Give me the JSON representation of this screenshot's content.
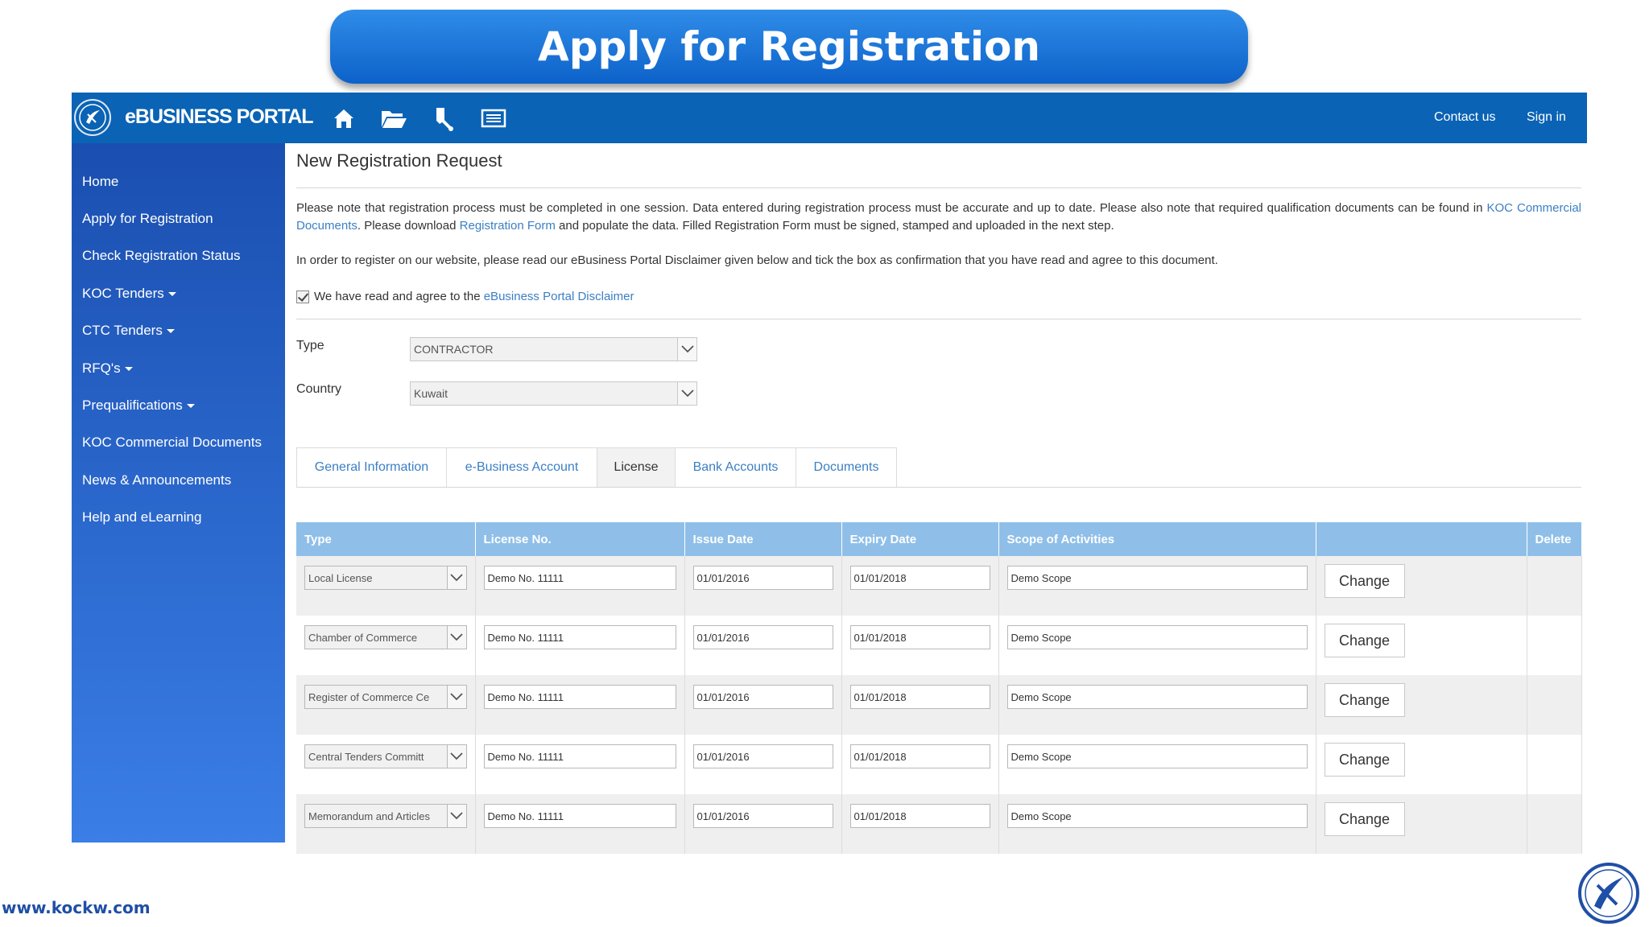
{
  "banner": {
    "title": "Apply for Registration"
  },
  "header": {
    "portal_title": "eBUSINESS PORTAL",
    "nav_icons": [
      "home-icon",
      "folder-icon",
      "tools-icon",
      "list-icon"
    ],
    "contact_label": "Contact us",
    "signin_label": "Sign in"
  },
  "sidebar": {
    "items": [
      {
        "label": "Home",
        "dropdown": false
      },
      {
        "label": "Apply for Registration",
        "dropdown": false
      },
      {
        "label": "Check Registration Status",
        "dropdown": false
      },
      {
        "label": "KOC Tenders",
        "dropdown": true
      },
      {
        "label": "CTC Tenders",
        "dropdown": true
      },
      {
        "label": "RFQ's",
        "dropdown": true
      },
      {
        "label": "Prequalifications",
        "dropdown": true
      },
      {
        "label": "KOC Commercial Documents",
        "dropdown": false
      },
      {
        "label": "News & Announcements",
        "dropdown": false
      },
      {
        "label": "Help and eLearning",
        "dropdown": false
      }
    ]
  },
  "main": {
    "title": "New Registration Request",
    "para1": {
      "part1": "Please note that registration process must be completed in one session. Data entered during registration process must be accurate and up to date. Please also note that required qualification documents can be found in ",
      "link1": "KOC Commercial Documents",
      "part2": ". Please download ",
      "link2": "Registration Form",
      "part3": " and populate the data. Filled Registration Form must be signed, stamped and uploaded in the next step."
    },
    "para2": "In order to register on our website, please read our eBusiness Portal Disclaimer given below and tick the box as confirmation that you have read and agree to this document.",
    "agree_text": "We have read and agree to the ",
    "agree_link": "eBusiness Portal Disclaimer",
    "agree_checked": true,
    "type_label": "Type",
    "type_value": "CONTRACTOR",
    "country_label": "Country",
    "country_value": "Kuwait",
    "tabs": [
      "General Information",
      "e-Business Account",
      "License",
      "Bank Accounts",
      "Documents"
    ],
    "active_tab": "License",
    "table": {
      "headers": [
        "Type",
        "License No.",
        "Issue Date",
        "Expiry Date",
        "Scope of Activities",
        "",
        "Delete"
      ],
      "change_label": "Change",
      "rows": [
        {
          "type": "Local License",
          "license_no": "Demo No. 11111",
          "issue": "01/01/2016",
          "expiry": "01/01/2018",
          "scope": "Demo Scope"
        },
        {
          "type": "Chamber of Commerce",
          "license_no": "Demo No. 11111",
          "issue": "01/01/2016",
          "expiry": "01/01/2018",
          "scope": "Demo Scope"
        },
        {
          "type": "Register of Commerce Ce",
          "license_no": "Demo No. 11111",
          "issue": "01/01/2016",
          "expiry": "01/01/2018",
          "scope": "Demo Scope"
        },
        {
          "type": "Central Tenders Committ",
          "license_no": "Demo No. 11111",
          "issue": "01/01/2016",
          "expiry": "01/01/2018",
          "scope": "Demo Scope"
        },
        {
          "type": "Memorandum and Articles",
          "license_no": "Demo No. 11111",
          "issue": "01/01/2016",
          "expiry": "01/01/2018",
          "scope": "Demo Scope"
        }
      ]
    }
  },
  "footer": {
    "website": "www.kockw.com"
  },
  "colors": {
    "header_blue": "#0a63b5",
    "sidebar_blue": "#2a67cf",
    "table_header": "#8fbfe8",
    "link": "#3b7fc4",
    "banner": "#1270d6"
  }
}
